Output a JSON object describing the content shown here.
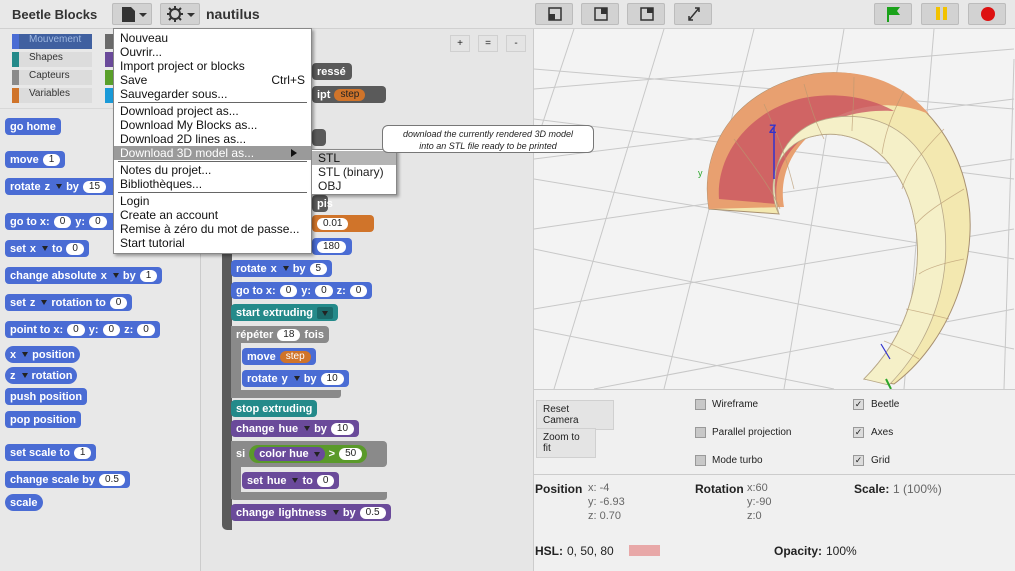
{
  "app": {
    "title": "Beetle Blocks",
    "project_name": "nautilus"
  },
  "toolbar": {
    "file_icon": "file-icon",
    "settings_icon": "gear-icon",
    "layout_buttons": [
      "layout-normal-icon",
      "layout-split-icon",
      "layout-stage-icon",
      "fullscreen-icon"
    ],
    "run_buttons": {
      "start": "green-flag-icon",
      "pause": "pause-icon",
      "stop": "stop-icon"
    },
    "colors": {
      "green": "#1aa21a",
      "yellow": "#f2c200",
      "red": "#dd1111",
      "button_bg": "#d2d2d2"
    }
  },
  "categories": [
    {
      "label": "Mouvement",
      "color": "#4a6cd4",
      "selected": true
    },
    {
      "label": "Shapes",
      "color": "#248a8a"
    },
    {
      "label": "Capteurs",
      "color": "#8a8a8a"
    },
    {
      "label": "Variables",
      "color": "#d0742a"
    }
  ],
  "palette_blocks": {
    "go_home": "go home",
    "move": "move",
    "move_val": "1",
    "rotate": "rotate",
    "rotate_axis": "z",
    "rotate_by": "by",
    "rotate_val": "15",
    "goto": "go to x:",
    "goto_x": "0",
    "goto_y_label": "y:",
    "goto_y": "0",
    "set": "set",
    "set_axis": "x",
    "set_to": "to",
    "set_val": "0",
    "change_abs": "change absolute",
    "change_abs_axis": "x",
    "change_abs_by": "by",
    "change_abs_val": "1",
    "set_rot": "set",
    "set_rot_axis": "z",
    "set_rot_label": "rotation to",
    "set_rot_val": "0",
    "point_to": "point to x:",
    "point_x": "0",
    "point_y_label": "y:",
    "point_y": "0",
    "point_z_label": "z:",
    "point_z": "0",
    "pos_axis": "x",
    "position": "position",
    "rot_axis": "z",
    "rotation": "rotation",
    "push": "push position",
    "pop": "pop position",
    "set_scale": "set scale to",
    "set_scale_val": "1",
    "change_scale": "change scale by",
    "change_scale_val": "0.5",
    "scale": "scale"
  },
  "script": {
    "zoom": {
      "plus": "+",
      "equal": "=",
      "minus": "-"
    },
    "pressed": "ressé",
    "script_word": "ipt",
    "step_var": "step",
    "pis": "pis",
    "v001": "0.01",
    "v180": "180",
    "rotate": "rotate",
    "rotate_axis": "x",
    "rotate_by": "by",
    "rotate_val": "5",
    "goto": "go to x:",
    "goto_x": "0",
    "goto_y_label": "y:",
    "goto_y": "0",
    "goto_z_label": "z:",
    "goto_z": "0",
    "start_extruding": "start extruding",
    "repeat": "répéter",
    "repeat_val": "18",
    "repeat_times": "fois",
    "move": "move",
    "move_step": "step",
    "rotate2": "rotate",
    "rotate2_axis": "y",
    "rotate2_by": "by",
    "rotate2_val": "10",
    "stop_extruding": "stop extruding",
    "change_hue": "change",
    "hue_word": "hue",
    "change_hue_by": "by",
    "change_hue_val": "10",
    "if": "si",
    "color": "color",
    "color_hue": "hue",
    "gt": ">",
    "gt_val": "50",
    "set_hue": "set",
    "set_hue_word": "hue",
    "set_hue_to": "to",
    "set_hue_val": "0",
    "change_light": "change",
    "lightness_word": "lightness",
    "change_light_by": "by",
    "change_light_val": "0.5"
  },
  "file_menu": {
    "items": [
      {
        "label": "Nouveau"
      },
      {
        "label": "Ouvrir..."
      },
      {
        "label": "Import project or blocks"
      },
      {
        "label": "Save",
        "shortcut": "Ctrl+S"
      },
      {
        "label": "Sauvegarder sous..."
      },
      {
        "label": "Download project as..."
      },
      {
        "label": "Download My Blocks as..."
      },
      {
        "label": "Download 2D lines as..."
      },
      {
        "label": "Download 3D model as...",
        "highlighted": true
      },
      {
        "label": "Notes du projet..."
      },
      {
        "label": "Bibliothèques..."
      },
      {
        "label": "Login"
      },
      {
        "label": "Create an account"
      },
      {
        "label": "Remise à zéro du mot de passe..."
      },
      {
        "label": "Start tutorial"
      }
    ],
    "submenu": [
      "STL",
      "STL (binary)",
      "OBJ"
    ],
    "tooltip_line1": "download the currently rendered 3D model",
    "tooltip_line2": "into an STL file ready to be printed"
  },
  "stage": {
    "axis_labels": {
      "z": "Z",
      "y": "y"
    },
    "shell_colors": [
      "#f3e8b0",
      "#e8a070",
      "#c85060",
      "#f5f0c8"
    ]
  },
  "controls": {
    "reset_camera": "Reset Camera",
    "zoom_fit": "Zoom to fit",
    "wireframe": {
      "label": "Wireframe",
      "checked": false
    },
    "parallel": {
      "label": "Parallel projection",
      "checked": false
    },
    "turbo": {
      "label": "Mode turbo",
      "checked": false
    },
    "beetle": {
      "label": "Beetle",
      "checked": true
    },
    "axes": {
      "label": "Axes",
      "checked": true
    },
    "grid": {
      "label": "Grid",
      "checked": true
    },
    "check_mark": "✓",
    "position_label": "Position",
    "pos_x": "x: -4",
    "pos_y": "y: -6.93",
    "pos_z": "z: 0.70",
    "rotation_label": "Rotation",
    "rot_x": "x:60",
    "rot_y": "y:-90",
    "rot_z": "z:0",
    "scale_label": "Scale:",
    "scale_val": "1 (100%)",
    "hsl_label": "HSL:",
    "hsl_val": "0, 50, 80",
    "hsl_swatch": "#e8a8a8",
    "opacity_label": "Opacity:",
    "opacity_val": "100%"
  }
}
